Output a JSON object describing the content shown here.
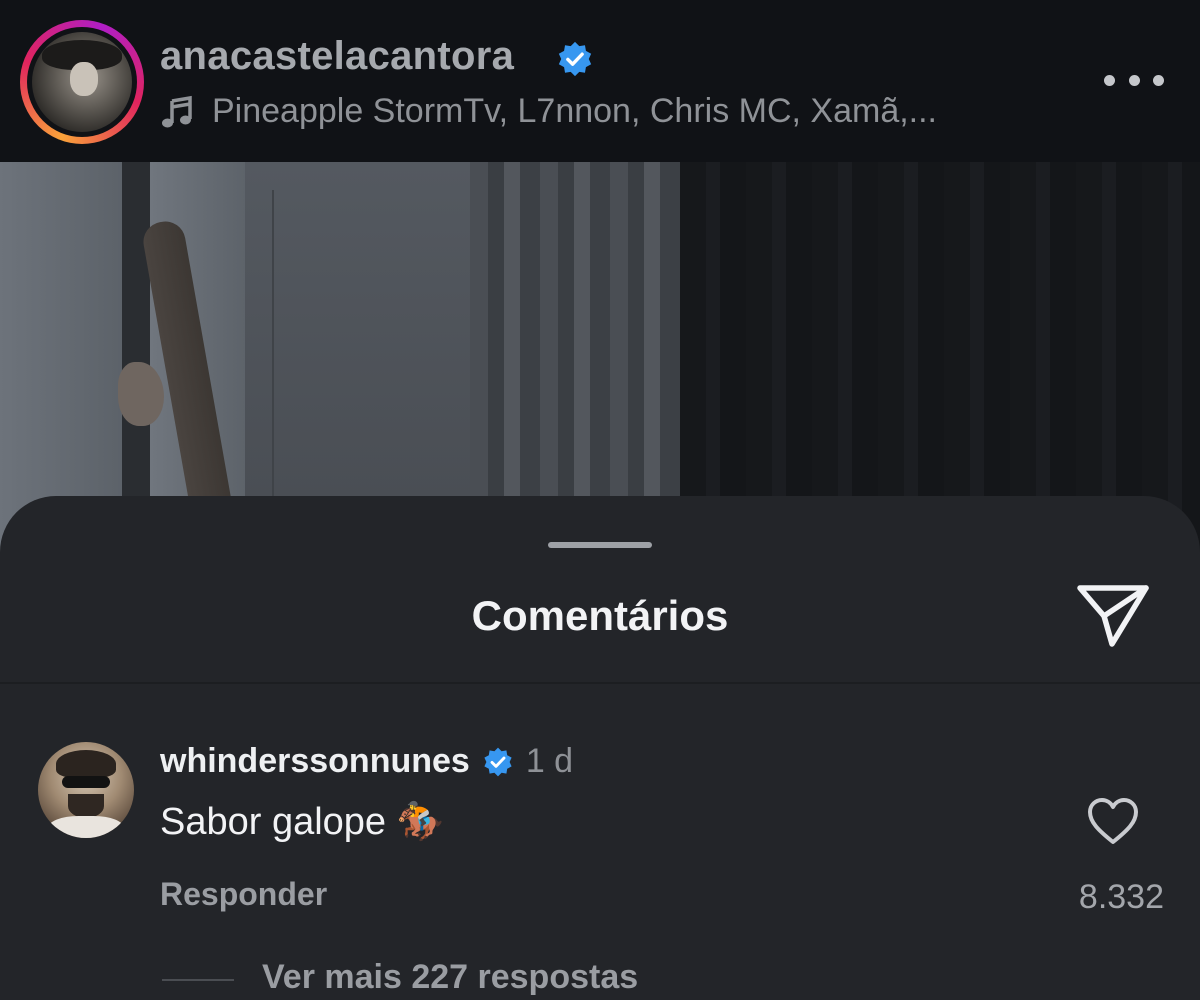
{
  "header": {
    "username": "anacastelacantora",
    "music_text": "Pineapple StormTv, L7nnon, Chris MC, Xamã,...",
    "icons": {
      "verified": "verified-badge-icon",
      "music": "music-note-icon",
      "more": "more-options-icon"
    }
  },
  "sheet": {
    "title": "Comentários",
    "share_icon": "send-icon"
  },
  "comment": {
    "username": "whinderssonnunes",
    "time": "1 d",
    "text": "Sabor galope 🏇",
    "reply_label": "Responder",
    "like_count": "8.332",
    "view_replies": "Ver mais 227 respostas",
    "icons": {
      "verified": "verified-badge-icon",
      "like": "heart-icon"
    }
  },
  "colors": {
    "verified_blue": "#3797f0",
    "sheet_background": "#232529",
    "header_background": "#101216"
  }
}
